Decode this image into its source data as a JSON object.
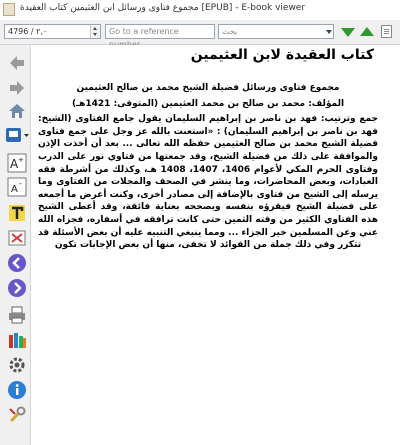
{
  "window": {
    "title": "مجموع فتاوى ورسائل ابن العثيمين كتاب العقيدة [EPUB] - E-book viewer"
  },
  "toolbar": {
    "position_value": "4796 / ٢,٠",
    "reference_placeholder": "Go to a reference number...",
    "search_placeholder": "بحث"
  },
  "sidebar": {
    "items": [
      {
        "icon": "back-arrow-icon"
      },
      {
        "icon": "forward-arrow-icon"
      },
      {
        "icon": "home-icon"
      },
      {
        "icon": "bookmark-icon"
      },
      {
        "icon": "font-larger-icon"
      },
      {
        "icon": "font-smaller-icon"
      },
      {
        "icon": "text-style-icon"
      },
      {
        "icon": "fullscreen-icon"
      },
      {
        "icon": "previous-page-icon"
      },
      {
        "icon": "next-page-icon"
      },
      {
        "icon": "print-icon"
      },
      {
        "icon": "library-icon"
      },
      {
        "icon": "preferences-icon"
      },
      {
        "icon": "info-icon"
      },
      {
        "icon": "tools-icon"
      }
    ]
  },
  "content": {
    "title": "كتاب العقيدة لابن العثيمين",
    "paragraphs": [
      "مجموع فتاوى ورسائل فضيلة الشيخ محمد بن صالح العثيمين",
      "المؤلف: محمد بن صالح بن محمد العثيمين (المتوفى: 1421هـ)",
      "جمع وترتيب: فهد بن ناصر بن إبراهيم السليمان يقول جامع الفتاوى (الشيخ: فهد بن ناصر بن إبراهيم السليمان) : «استعنت بالله عز وجل على جمع فتاوى فضيلة الشيخ محمد بن صالح العثيمين حفظه الله تعالى ... بعد أن أخذت الإذن والموافقة على ذلك من فضيلة الشيخ، وقد جمعتها من فتاوي نور على الدرب وفتاوى الحرم المكي لأعوام 1406، 1407، 1408 هـ، وكذلك من أشرطة فقه العبادات، وبعض المحاضرات، وما ينشر في الصحف والمجلات من الفتاوى وما يرسله إلى الشيخ من فتاوى بالإضافة إلى مصادر أخرى، وكنت أعرض ما أجمعه على فضيلة الشيخ فيقرؤه بنفسه ويصححه بعناية فائقة، وقد أعطى الشيخ هذه الفتاوي الكثير من وقته الثمين حتى كانت ترافقه في أسفاره، فجزاه الله عني وعن المسلمين خير الجزاء ... ومما ينبغي التنبيه عليه أن بعض الأسئلة قد تتكرر وفي ذلك جملة من الفوائد لا تخفى، منها أن بعض الإجابات تكون"
    ]
  }
}
